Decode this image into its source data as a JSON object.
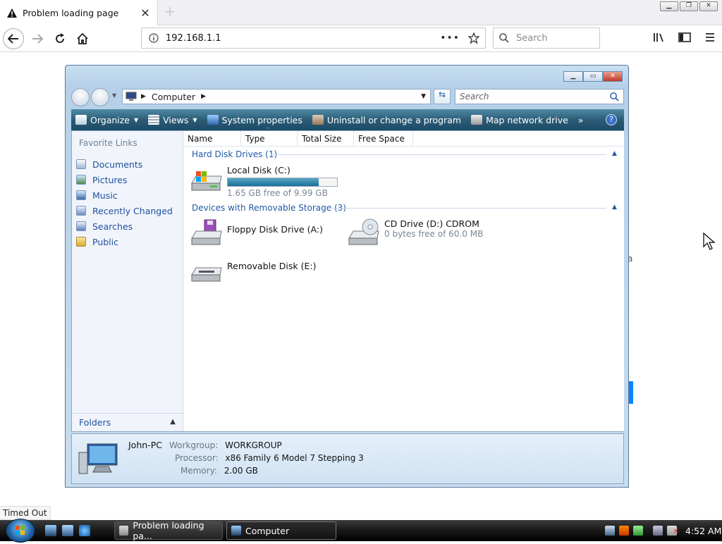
{
  "browser": {
    "tab_title": "Problem loading page",
    "url": "192.168.1.1",
    "search_placeholder": "Search",
    "status_popup": "Timed Out"
  },
  "explorer": {
    "breadcrumb": "Computer",
    "search_placeholder": "Search",
    "toolbar": {
      "organize": "Organize",
      "views": "Views",
      "system_properties": "System properties",
      "uninstall": "Uninstall or change a program",
      "map_drive": "Map network drive",
      "more": "»"
    },
    "favorite_links": {
      "title": "Favorite Links",
      "items": [
        "Documents",
        "Pictures",
        "Music",
        "Recently Changed",
        "Searches",
        "Public"
      ]
    },
    "folders_label": "Folders",
    "columns": [
      "Name",
      "Type",
      "Total Size",
      "Free Space"
    ],
    "groups": {
      "hdd": "Hard Disk Drives (1)",
      "removable": "Devices with Removable Storage (3)"
    },
    "drives": {
      "c": {
        "name": "Local Disk (C:)",
        "free": "1.65 GB free of 9.99 GB",
        "used_fraction": 0.83
      },
      "a": {
        "name": "Floppy Disk Drive (A:)"
      },
      "d": {
        "name": "CD Drive (D:) CDROM",
        "free": "0 bytes free of 60.0 MB"
      },
      "e": {
        "name": "Removable Disk (E:)"
      }
    },
    "details": {
      "computer_name": "John-PC",
      "workgroup_label": "Workgroup:",
      "workgroup": "WORKGROUP",
      "processor_label": "Processor:",
      "processor": "x86 Family 6 Model 7 Stepping 3",
      "memory_label": "Memory:",
      "memory": "2.00 GB"
    }
  },
  "taskbar": {
    "tasks": [
      "Problem loading pa...",
      "Computer"
    ],
    "clock": "4:52 AM"
  },
  "colors": {
    "accent": "#1f5aa6",
    "toolbar": "#2c5c76"
  }
}
